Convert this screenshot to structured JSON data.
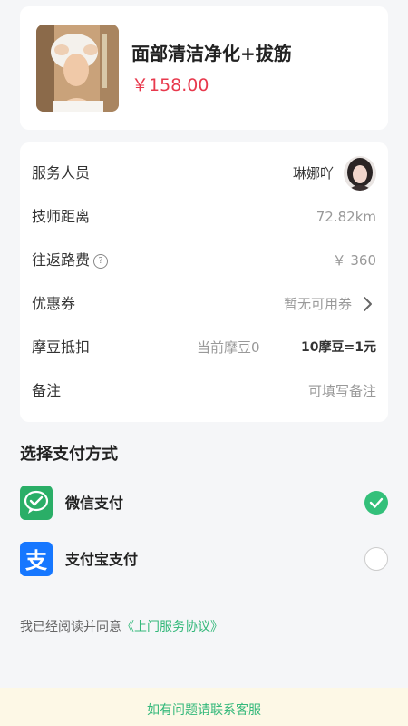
{
  "product": {
    "title": "面部清洁净化+拔筋",
    "price": "￥158.00"
  },
  "details": {
    "staff_label": "服务人员",
    "staff_name": "琳娜吖",
    "distance_label": "技师距离",
    "distance_value": "72.82km",
    "fee_label": "往返路费",
    "fee_help": "?",
    "fee_value": "￥ 360",
    "coupon_label": "优惠券",
    "coupon_value": "暂无可用券",
    "beans_label": "摩豆抵扣",
    "beans_current": "当前摩豆0",
    "beans_rate": "10摩豆=1元",
    "note_label": "备注",
    "note_placeholder": "可填写备注"
  },
  "payment": {
    "section_title": "选择支付方式",
    "methods": [
      {
        "label": "微信支付",
        "icon": "wechat-pay-icon",
        "selected": true
      },
      {
        "label": "支付宝支付",
        "icon": "alipay-icon",
        "selected": false
      }
    ]
  },
  "agreement": {
    "text": "我已经阅读并同意",
    "link": "《上门服务协议》"
  },
  "footer": {
    "text": "如有问题请联系客服"
  },
  "colors": {
    "price": "#e8394d",
    "accent_green": "#33c07a",
    "wechat": "#2aae67",
    "alipay": "#1677ff",
    "footer_bg": "#fdf8e6"
  }
}
